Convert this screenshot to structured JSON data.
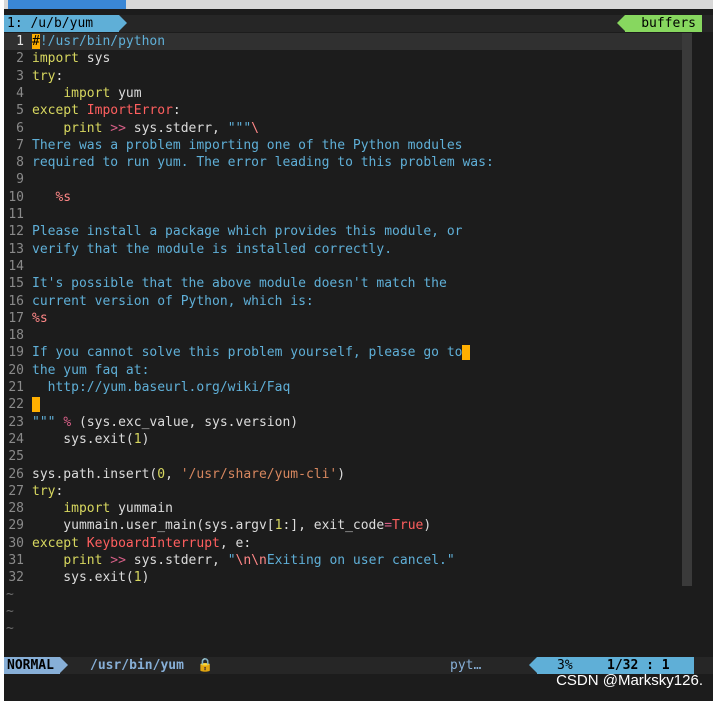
{
  "window_title": "",
  "tabline": {
    "tab_label": "1: /u/b/yum",
    "buffers_label": "buffers"
  },
  "editor": {
    "current_line": 1,
    "lines": [
      {
        "n": "1",
        "code": "#!/usr/bin/python"
      },
      {
        "n": "2",
        "code": "import sys"
      },
      {
        "n": "3",
        "code": "try:"
      },
      {
        "n": "4",
        "code": "    import yum"
      },
      {
        "n": "5",
        "code": "except ImportError:"
      },
      {
        "n": "6",
        "code": "    print >> sys.stderr, \"\"\"\\"
      },
      {
        "n": "7",
        "code": "There was a problem importing one of the Python modules"
      },
      {
        "n": "8",
        "code": "required to run yum. The error leading to this problem was:"
      },
      {
        "n": "9",
        "code": ""
      },
      {
        "n": "10",
        "code": "   %s"
      },
      {
        "n": "11",
        "code": ""
      },
      {
        "n": "12",
        "code": "Please install a package which provides this module, or"
      },
      {
        "n": "13",
        "code": "verify that the module is installed correctly."
      },
      {
        "n": "14",
        "code": ""
      },
      {
        "n": "15",
        "code": "It's possible that the above module doesn't match the"
      },
      {
        "n": "16",
        "code": "current version of Python, which is:"
      },
      {
        "n": "17",
        "code": "%s"
      },
      {
        "n": "18",
        "code": ""
      },
      {
        "n": "19",
        "code": "If you cannot solve this problem yourself, please go to"
      },
      {
        "n": "20",
        "code": "the yum faq at:"
      },
      {
        "n": "21",
        "code": "  http://yum.baseurl.org/wiki/Faq"
      },
      {
        "n": "22",
        "code": ""
      },
      {
        "n": "23",
        "code": "\"\"\" % (sys.exc_value, sys.version)"
      },
      {
        "n": "24",
        "code": "    sys.exit(1)"
      },
      {
        "n": "25",
        "code": ""
      },
      {
        "n": "26",
        "code": "sys.path.insert(0, '/usr/share/yum-cli')"
      },
      {
        "n": "27",
        "code": "try:"
      },
      {
        "n": "28",
        "code": "    import yummain"
      },
      {
        "n": "29",
        "code": "    yummain.user_main(sys.argv[1:], exit_code=True)"
      },
      {
        "n": "30",
        "code": "except KeyboardInterrupt, e:"
      },
      {
        "n": "31",
        "code": "    print >> sys.stderr, \"\\n\\nExiting on user cancel.\""
      },
      {
        "n": "32",
        "code": "    sys.exit(1)"
      }
    ],
    "tilde": "~"
  },
  "statusline": {
    "mode": "NORMAL",
    "filename": "/usr/bin/yum",
    "lock_icon": "lock-icon",
    "filetype": "pyt…",
    "percent": "3%",
    "position": "1/32 :  1"
  },
  "watermark": "CSDN @Marksky126.",
  "colors": {
    "background": "#1c1c1c",
    "keyword": "#d7d75f",
    "string": "#5fafd7",
    "cursor": "#ffaf00",
    "mode_bg": "#87afd7",
    "buffers_bg": "#87d75f"
  }
}
